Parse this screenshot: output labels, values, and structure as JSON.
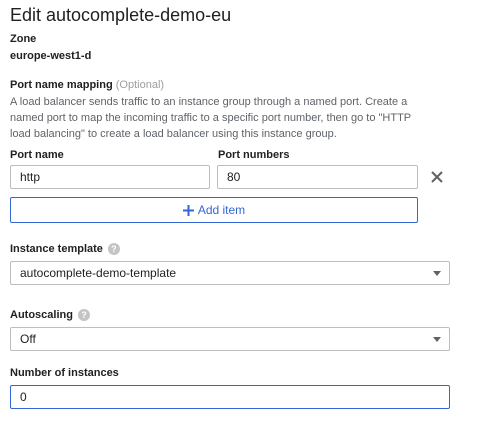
{
  "header": {
    "title": "Edit autocomplete-demo-eu"
  },
  "zone": {
    "label": "Zone",
    "value": "europe-west1-d"
  },
  "port_mapping": {
    "label": "Port name mapping",
    "optional": "(Optional)",
    "description": "A load balancer sends traffic to an instance group through a named port. Create a named port to map the incoming traffic to a specific port number, then go to \"HTTP load balancing\" to create a load balancer using this instance group.",
    "port_name_label": "Port name",
    "port_numbers_label": "Port numbers",
    "port_name_value": "http",
    "port_numbers_value": "80",
    "add_item_label": "Add item"
  },
  "instance_template": {
    "label": "Instance template",
    "value": "autocomplete-demo-template"
  },
  "autoscaling": {
    "label": "Autoscaling",
    "value": "Off"
  },
  "instances": {
    "label": "Number of instances",
    "value": "0"
  },
  "icons": {
    "add": "plus-icon",
    "remove": "close-icon",
    "help": "help-icon",
    "dropdown": "caret-down-icon"
  },
  "colors": {
    "accent": "#3367d6",
    "border": "#bdbdbd",
    "text": "#202124",
    "muted": "#5f6368"
  }
}
